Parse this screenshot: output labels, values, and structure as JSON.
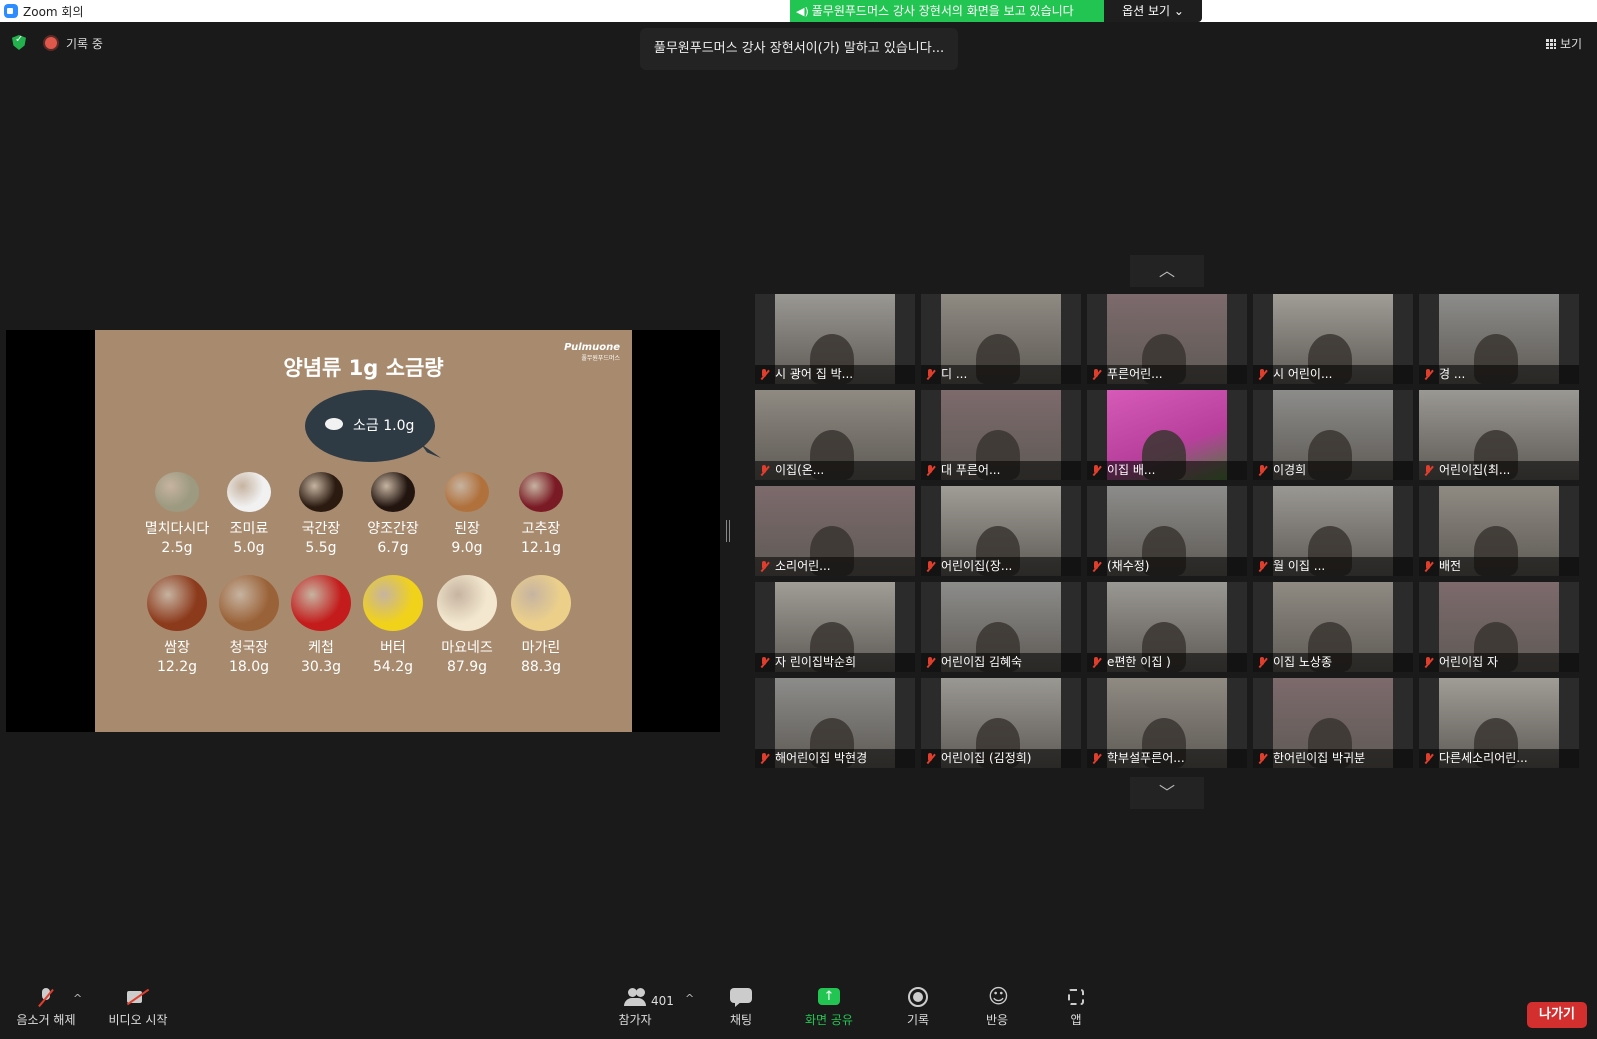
{
  "window": {
    "title": "Zoom 회의"
  },
  "banner": {
    "text": "풀무원푸드머스 강사 장현서의 화면을 보고 있습니다",
    "options_label": "옵션 보기 ⌄"
  },
  "status": {
    "recording_label": "기록 중",
    "speaking_text": "풀무원푸드머스 강사 장현서이(가) 말하고 있습니다...",
    "view_label": "보기"
  },
  "slide": {
    "title": "양념류 1g 소금량",
    "brand": "Pulmuone",
    "brand_sub": "풀무원푸드머스",
    "salt_label": "소금 1.0g",
    "row1": [
      {
        "name": "멸치다시다",
        "value": "2.5g",
        "color": "#9c9a80"
      },
      {
        "name": "조미료",
        "value": "5.0g",
        "color": "#f1f1f1"
      },
      {
        "name": "국간장",
        "value": "5.5g",
        "color": "#2a1a10"
      },
      {
        "name": "양조간장",
        "value": "6.7g",
        "color": "#221510"
      },
      {
        "name": "된장",
        "value": "9.0g",
        "color": "#b0713c"
      },
      {
        "name": "고추장",
        "value": "12.1g",
        "color": "#7a1a24"
      }
    ],
    "row2": [
      {
        "name": "쌈장",
        "value": "12.2g",
        "color": "#8c3a1c"
      },
      {
        "name": "청국장",
        "value": "18.0g",
        "color": "#9a6238"
      },
      {
        "name": "케첩",
        "value": "30.3g",
        "color": "#c41c1c"
      },
      {
        "name": "버터",
        "value": "54.2g",
        "color": "#f1d21a"
      },
      {
        "name": "마요네즈",
        "value": "87.9g",
        "color": "#f3e8cf"
      },
      {
        "name": "마가린",
        "value": "88.3g",
        "color": "#ecd08a"
      }
    ]
  },
  "gallery": {
    "up_label": "︿",
    "down_label": "﹀",
    "tiles": [
      {
        "name": "시      광어      집 박..."
      },
      {
        "name": "디                                ..."
      },
      {
        "name": "            푸른어린..."
      },
      {
        "name": "시                      어린이..."
      },
      {
        "name": "경      ..."
      },
      {
        "name": "              이집(온..."
      },
      {
        "name": "대              푸른어..."
      },
      {
        "name": "                 이집 배..."
      },
      {
        "name": "        이경희"
      },
      {
        "name": "           어린이집(최..."
      },
      {
        "name": "           소리어린..."
      },
      {
        "name": "         어린이집(장..."
      },
      {
        "name": "              (채수정)"
      },
      {
        "name": "월          이집 ..."
      },
      {
        "name": "                 배전"
      },
      {
        "name": "자      린이집박순희"
      },
      {
        "name": "       어린이집 김혜숙"
      },
      {
        "name": "e편한      이집      )"
      },
      {
        "name": "              이집 노상종"
      },
      {
        "name": "         어린이집      자"
      },
      {
        "name": "      해어린이집 박현경"
      },
      {
        "name": "       어린이집 (김정희)"
      },
      {
        "name": "     학부설푸른어..."
      },
      {
        "name": "      한어린이집 박귀분"
      },
      {
        "name": "다른세소리어린..."
      }
    ]
  },
  "toolbar": {
    "mute_label": "음소거 해제",
    "video_label": "비디오 시작",
    "participants_label": "참가자",
    "participants_count": "401",
    "chat_label": "채팅",
    "share_label": "화면 공유",
    "record_label": "기록",
    "reactions_label": "반응",
    "apps_label": "앱",
    "leave_label": "나가기"
  }
}
